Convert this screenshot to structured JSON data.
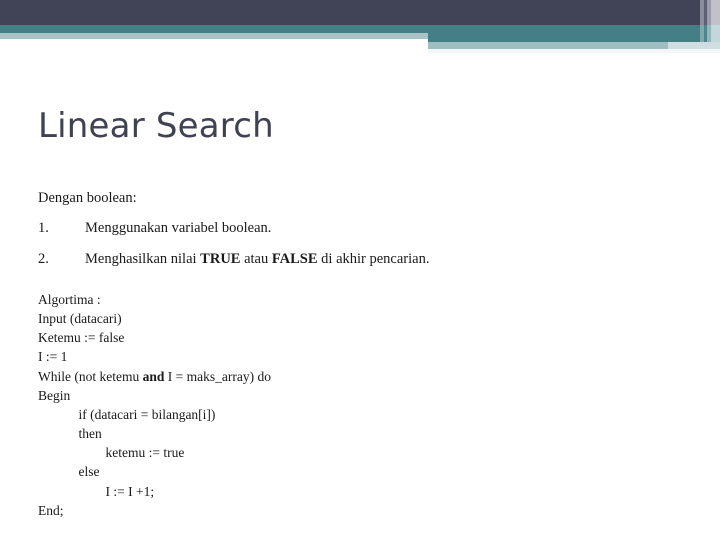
{
  "header": {
    "colors": {
      "navy": "#414456",
      "teal": "#437f85",
      "light_blue": "#a8c2c6",
      "pale": "#f2f7f7",
      "accent_gray": "#c0c1c9"
    }
  },
  "title": "Linear Search",
  "body": {
    "intro": "Dengan boolean:",
    "list": [
      {
        "marker": "1.",
        "text": "Menggunakan variabel boolean."
      },
      {
        "marker": "2.",
        "text_before": "Menghasilkan nilai ",
        "bold1": "TRUE",
        "text_mid": " atau ",
        "bold2": "FALSE",
        "text_after": " di akhir pencarian."
      }
    ]
  },
  "algorithm": {
    "lines": [
      "Algortima :",
      "Input (datacari)",
      "Ketemu := false",
      "I := 1",
      "While (not ketemu and I = maks_array) do",
      "Begin",
      "            if (datacari = bilangan[i])",
      "            then",
      "                    ketemu := true",
      "            else",
      "                    I := I +1;",
      "End;"
    ],
    "while_prefix": "While (not ketemu ",
    "while_bold": "and",
    "while_suffix": " I = maks_array) do"
  }
}
